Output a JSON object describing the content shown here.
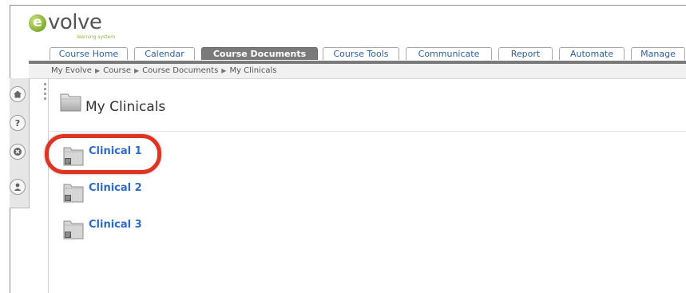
{
  "logo": {
    "letter": "e",
    "word": "volve",
    "tagline": "learning system"
  },
  "tabs": [
    {
      "label": "Course Home",
      "active": false
    },
    {
      "label": "Calendar",
      "active": false
    },
    {
      "label": "Course Documents",
      "active": true
    },
    {
      "label": "Course Tools",
      "active": false
    },
    {
      "label": "Communicate",
      "active": false
    },
    {
      "label": "Report",
      "active": false
    },
    {
      "label": "Automate",
      "active": false
    },
    {
      "label": "Manage",
      "active": false
    }
  ],
  "breadcrumb": [
    "My Evolve",
    "Course",
    "Course Documents",
    "My Clinicals"
  ],
  "side_tools": [
    {
      "icon": "home-icon"
    },
    {
      "icon": "help-icon"
    },
    {
      "icon": "close-icon"
    },
    {
      "icon": "user-icon"
    }
  ],
  "page": {
    "title": "My Clinicals"
  },
  "items": [
    {
      "label": "Clinical 1",
      "highlighted": true
    },
    {
      "label": "Clinical 2",
      "highlighted": false
    },
    {
      "label": "Clinical 3",
      "highlighted": false
    }
  ],
  "colors": {
    "link": "#2f6bc4",
    "active_tab": "#7a7a7a",
    "highlight": "#e03423",
    "logo_green": "#8db43a"
  }
}
